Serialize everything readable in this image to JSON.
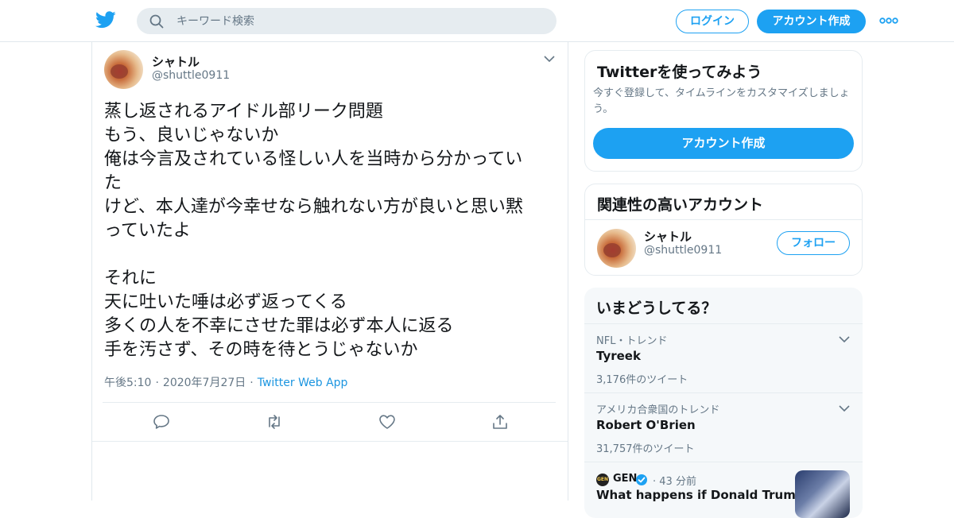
{
  "colors": {
    "accent": "#1da1f2",
    "link": "#1b95e0",
    "text_primary": "#14171a",
    "text_secondary": "#657786",
    "search_bg": "#e6ecf0",
    "trends_bg": "#f5f8fa"
  },
  "header": {
    "logo_icon": "twitter-bird-icon",
    "search_placeholder": "キーワード検索",
    "login_label": "ログイン",
    "signup_label": "アカウント作成",
    "more_icon": "more-dots-icon"
  },
  "tweet": {
    "author_name": "シャトル",
    "author_handle": "@shuttle0911",
    "lines": [
      "蒸し返されるアイドル部リーク問題",
      "もう、良いじゃないか",
      "俺は今言及されている怪しい人を当時から分かってい",
      "た",
      "けど、本人達が今幸せなら触れない方が良いと思い黙",
      "っていたよ",
      "",
      "それに",
      "天に吐いた唾は必ず返ってくる",
      "多くの人を不幸にさせた罪は必ず本人に返る",
      "手を汚さず、その時を待とうじゃないか"
    ],
    "time": "午後5:10",
    "date": "2020年7月27日",
    "source": "Twitter Web App",
    "separator": "·"
  },
  "sidebar": {
    "signup_card": {
      "title": "Twitterを使ってみよう",
      "description": "今すぐ登録して、タイムラインをカスタマイズしましょう。",
      "button_label": "アカウント作成"
    },
    "related_card": {
      "title": "関連性の高いアカウント",
      "account": {
        "name": "シャトル",
        "handle": "@shuttle0911",
        "follow_label": "フォロー"
      }
    },
    "trends_card": {
      "title": "いまどうしてる？",
      "trends": [
        {
          "context": "NFL・トレンド",
          "name": "Tyreek",
          "count": "3,176件のツイート"
        },
        {
          "context": "アメリカ合衆国のトレンド",
          "name": "Robert O'Brien",
          "count": "31,757件のツイート"
        }
      ],
      "news": {
        "source": "GEN",
        "logo_text": "GEN",
        "time": "43 分前",
        "headline": "What happens if Donald Trump"
      }
    }
  }
}
